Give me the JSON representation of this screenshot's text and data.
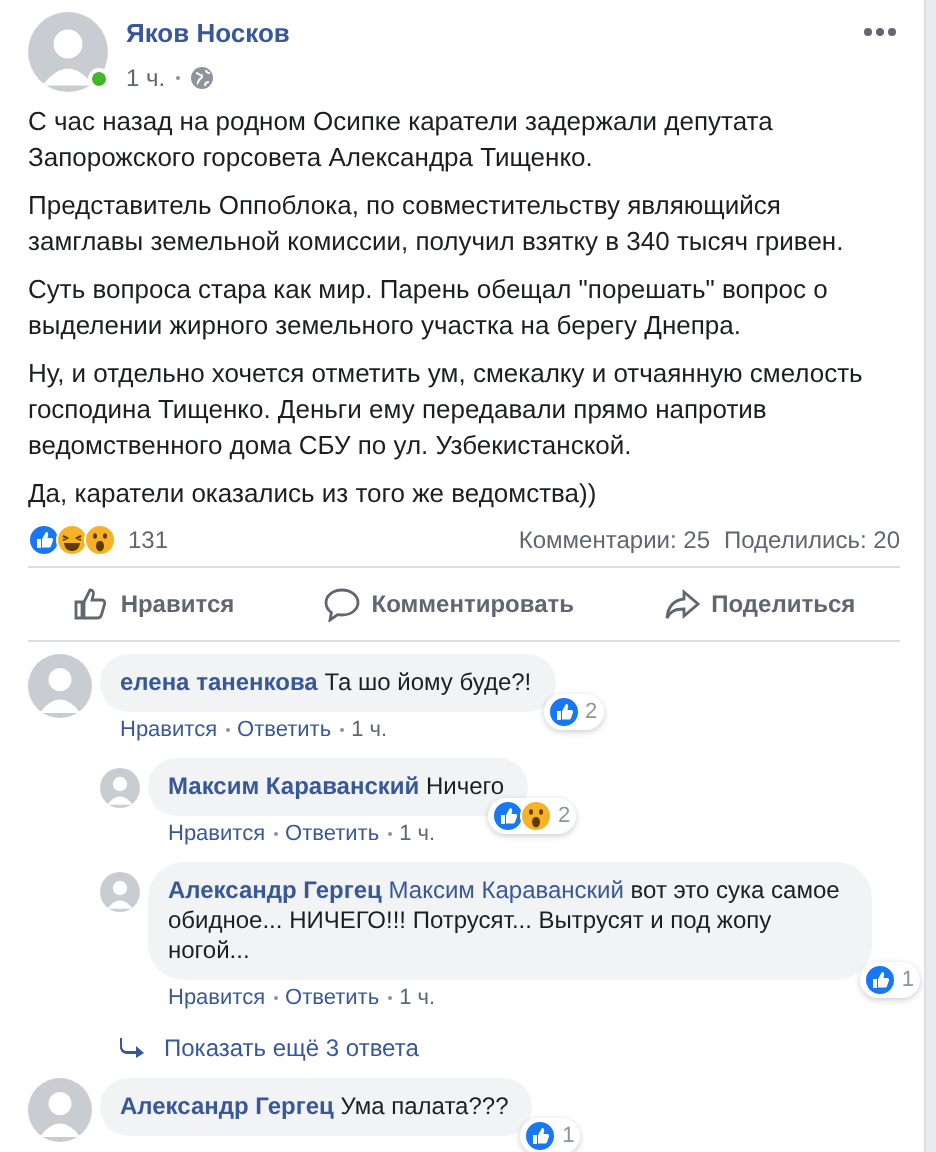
{
  "post": {
    "author": "Яков Носков",
    "time": "1 ч.",
    "online": true,
    "paragraphs": [
      "С час назад на родном Осипке каратели задержали депутата Запорожского горсовета Александра Тищенко.",
      "Представитель Оппоблока, по совместительству являющийся замглавы земельной комиссии, получил взятку в 340 тысяч гривен.",
      "Суть вопроса стара как мир. Парень обещал \"порешать\" вопрос о выделении жирного земельного участка на берегу Днепра.",
      "Ну, и отдельно хочется отметить ум, смекалку и отчаянную смелость господина Тищенко. Деньги ему передавали прямо напротив ведомственного дома СБУ по ул. Узбекистанской.",
      "Да, каратели оказались из того же ведомства))"
    ]
  },
  "summary": {
    "reactions": [
      {
        "kind": "like"
      },
      {
        "kind": "haha"
      },
      {
        "kind": "wow"
      }
    ],
    "count": "131",
    "comments": "Комментарии: 25",
    "shares": "Поделились: 20"
  },
  "actions": [
    {
      "kind": "like",
      "label": "Нравится"
    },
    {
      "kind": "comment",
      "label": "Комментировать"
    },
    {
      "kind": "share",
      "label": "Поделиться"
    }
  ],
  "comments": [
    {
      "author": "елена таненкова",
      "text": "Та шо йому буде?!",
      "reactions": [
        {
          "kind": "like"
        }
      ],
      "reaction_count": "2",
      "like": "Нравится",
      "reply": "Ответить",
      "time": "1 ч.",
      "replies": [
        {
          "author": "Максим Караванский",
          "text": "Ничего",
          "reactions": [
            {
              "kind": "like"
            },
            {
              "kind": "wow"
            }
          ],
          "reaction_count": "2",
          "like": "Нравится",
          "reply": "Ответить",
          "time": "1 ч."
        },
        {
          "author": "Александр Гергец",
          "mention": "Максим Караванский",
          "text": "вот это сука самое обидное... НИЧЕГО!!! Потрусят... Вытрусят и под жопу ногой...",
          "reactions": [
            {
              "kind": "like"
            }
          ],
          "reaction_count": "1",
          "like": "Нравится",
          "reply": "Ответить",
          "time": "1 ч."
        }
      ],
      "more_replies": "Показать ещё 3 ответа"
    },
    {
      "author": "Александр Гергец",
      "text": "Ума палата???",
      "reactions": [
        {
          "kind": "like"
        }
      ],
      "reaction_count": "1"
    }
  ]
}
